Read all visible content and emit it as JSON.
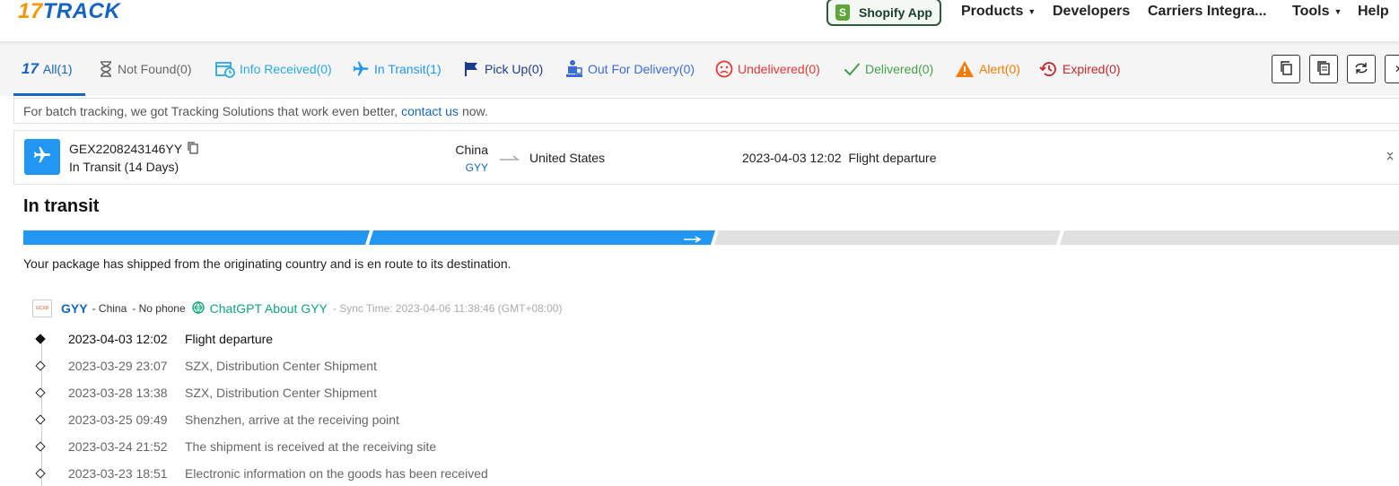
{
  "header": {
    "logo_num": "17",
    "logo_text": "TRACK",
    "shopify_label": "Shopify App",
    "nav": {
      "products": "Products",
      "developers": "Developers",
      "carriers": "Carriers Integra...",
      "tools": "Tools",
      "help": "Help"
    }
  },
  "tabs": [
    {
      "label": "All(1)",
      "color": "#1565c0",
      "icon": "17-logo-icon",
      "active": true
    },
    {
      "label": "Not Found(0)",
      "color": "#666666",
      "icon": "hourglass-icon"
    },
    {
      "label": "Info Received(0)",
      "color": "#29a9e1",
      "icon": "calendar-clock-icon"
    },
    {
      "label": "In Transit(1)",
      "color": "#2196f3",
      "icon": "plane-icon"
    },
    {
      "label": "Pick Up(0)",
      "color": "#1a3c8f",
      "icon": "flag-icon"
    },
    {
      "label": "Out For Delivery(0)",
      "color": "#3a6cd8",
      "icon": "delivery-person-icon"
    },
    {
      "label": "Undelivered(0)",
      "color": "#e53935",
      "icon": "sad-face-icon"
    },
    {
      "label": "Delivered(0)",
      "color": "#43a047",
      "icon": "check-icon"
    },
    {
      "label": "Alert(0)",
      "color": "#f57c00",
      "icon": "warning-icon"
    },
    {
      "label": "Expired(0)",
      "color": "#c62828",
      "icon": "history-icon"
    }
  ],
  "notice": {
    "before": "For batch tracking, we got Tracking Solutions that work even better,",
    "link": "contact us",
    "after": "now."
  },
  "shipment": {
    "tracking_number": "GEX2208243146YY",
    "status": "In Transit (14 Days)",
    "origin": "China",
    "origin_code": "GYY",
    "destination": "United States",
    "latest_time": "2023-04-03 12:02",
    "latest_desc": "Flight departure"
  },
  "detail": {
    "title": "In transit",
    "description": "Your package has shipped from the originating country and is en route to its destination.",
    "progress_steps_done": 2,
    "progress_steps_total": 4,
    "carrier": {
      "logo_text": "GCXB",
      "name": "GYY",
      "country": "- China",
      "phone": "- No phone",
      "chatgpt": "ChatGPT About GYY",
      "sync": "- Sync Time: 2023-04-06 11:38:46 (GMT+08:00)"
    },
    "events": [
      {
        "time": "2023-04-03 12:02",
        "desc": "Flight departure"
      },
      {
        "time": "2023-03-29 23:07",
        "desc": "SZX, Distribution Center Shipment"
      },
      {
        "time": "2023-03-28 13:38",
        "desc": "SZX, Distribution Center Shipment"
      },
      {
        "time": "2023-03-25 09:49",
        "desc": "Shenzhen, arrive at the receiving point"
      },
      {
        "time": "2023-03-24 21:52",
        "desc": "The shipment is received at the receiving site"
      },
      {
        "time": "2023-03-23 18:51",
        "desc": "Electronic information on the goods has been received"
      }
    ]
  },
  "colors": {
    "brand_blue": "#1565c0",
    "brand_orange": "#f39800",
    "progress_active": "#2196f3",
    "progress_inactive": "#e0e0e0"
  }
}
